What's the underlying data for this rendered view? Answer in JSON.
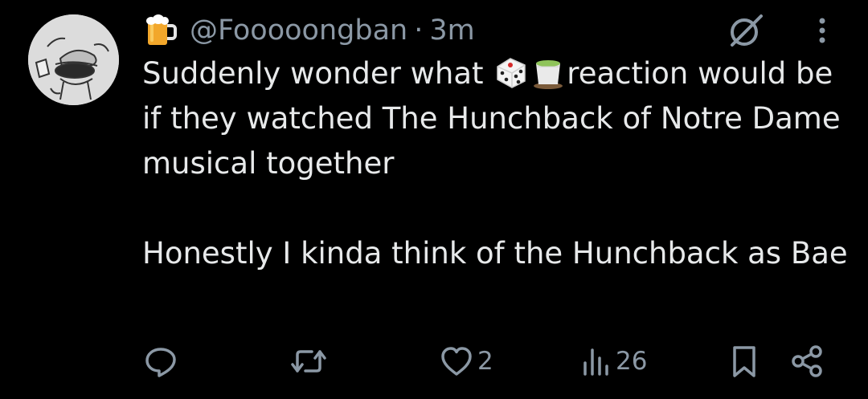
{
  "tweet": {
    "author_emoji": "beer-mug-icon",
    "handle": "@Fooooongban",
    "separator": "·",
    "time": "3m",
    "text_line1_pre": "Suddenly wonder what ",
    "text_emoji_1": "game-die-icon",
    "text_emoji_2": "matcha-tea-icon",
    "text_line1_post": "reaction would be if they watched The Hunchback of Notre Dame musical together",
    "text_para2": "Honestly I kinda think of the Hunchback as Bae"
  },
  "actions": {
    "replies": "",
    "retweets": "",
    "likes": "2",
    "views": "26"
  },
  "colors": {
    "background": "#000000",
    "text": "#e7e9ea",
    "muted": "#8b98a5"
  }
}
